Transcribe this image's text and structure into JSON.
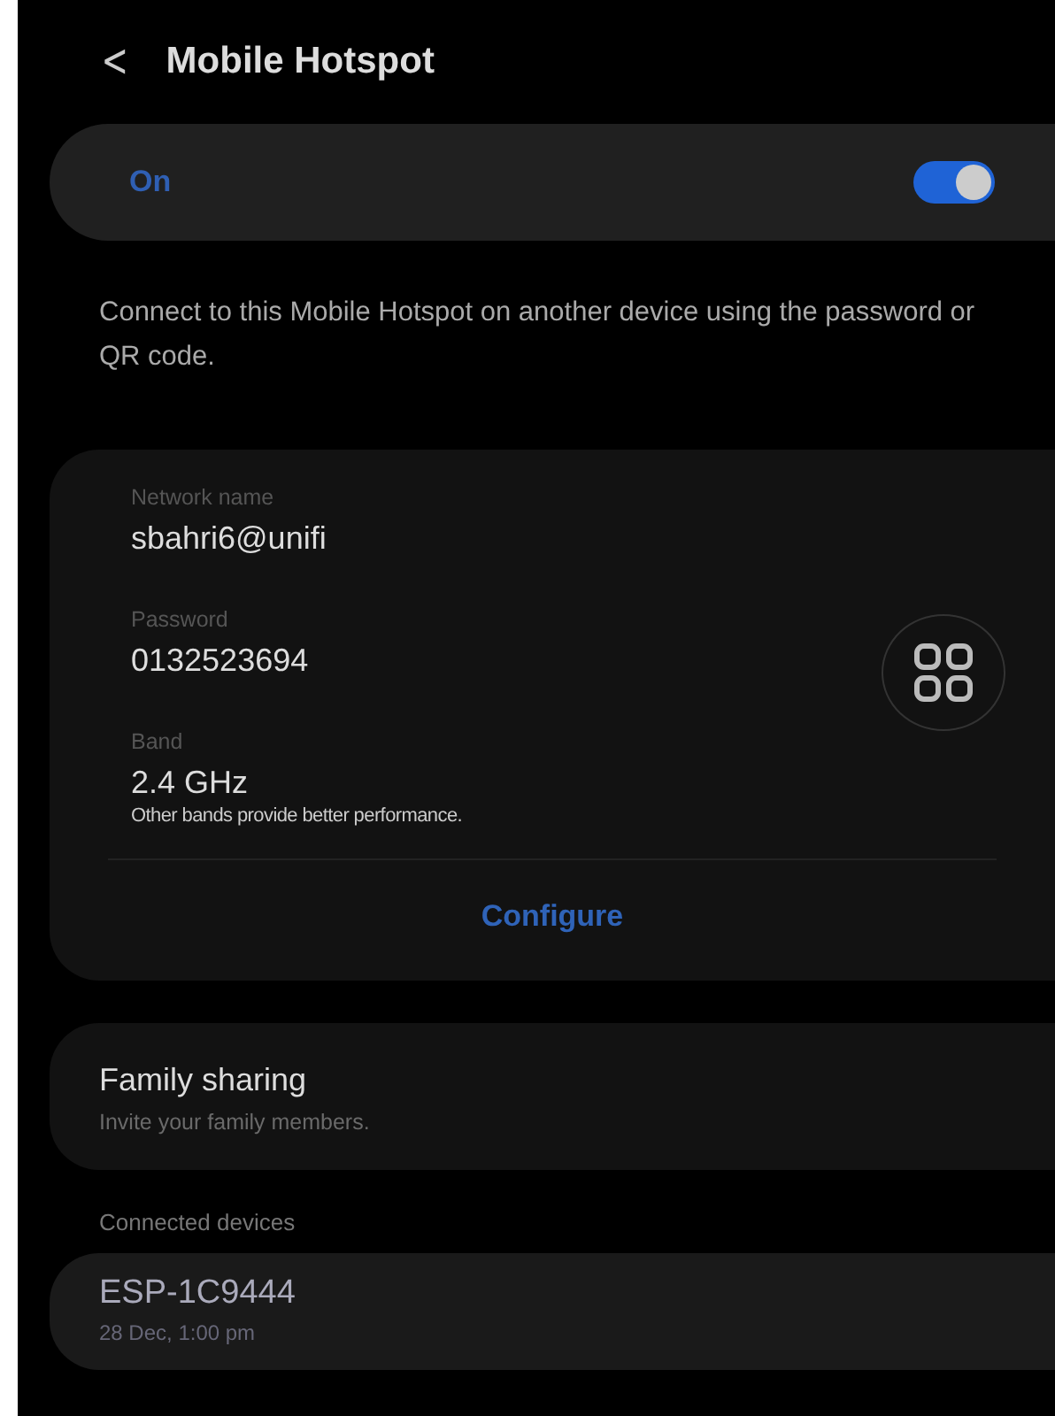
{
  "header": {
    "back": "<",
    "title": "Mobile Hotspot"
  },
  "master_switch": {
    "label": "On",
    "on": true
  },
  "description": "Connect to this Mobile Hotspot on another device using the password or QR code.",
  "details": [
    {
      "label": "Network name",
      "value": "sbahri6@unifi"
    },
    {
      "label": "Password",
      "value": "0132523694"
    },
    {
      "label": "Band",
      "value": "2.4 GHz",
      "note": "Other bands provide better performance."
    }
  ],
  "configure_button": "Configure",
  "family_sharing": {
    "title": "Family sharing",
    "subtitle": "Invite your family members."
  },
  "connected_devices": {
    "heading": "Connected devices",
    "devices": [
      {
        "name": "ESP-1C9444",
        "time": "28 Dec, 1:00 pm"
      }
    ]
  }
}
